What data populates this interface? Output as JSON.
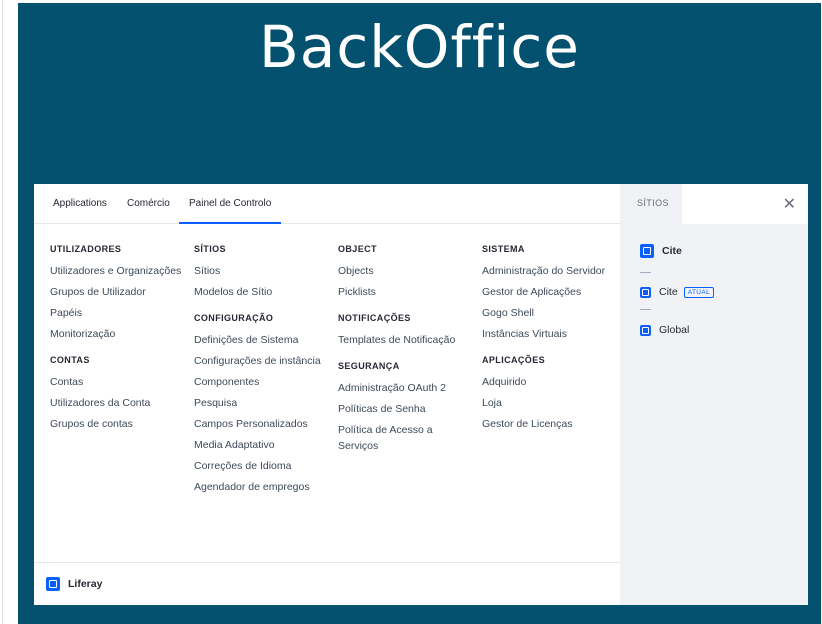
{
  "banner": {
    "title": "BackOffice"
  },
  "tabs": [
    {
      "label": "Applications"
    },
    {
      "label": "Comércio"
    },
    {
      "label": "Painel de Controlo"
    }
  ],
  "columns": [
    {
      "sections": [
        {
          "title": "UTILIZADORES",
          "items": [
            "Utilizadores e Organizações",
            "Grupos de Utilizador",
            "Papéis",
            "Monitorização"
          ]
        },
        {
          "title": "CONTAS",
          "items": [
            "Contas",
            "Utilizadores da Conta",
            "Grupos de contas"
          ]
        }
      ]
    },
    {
      "sections": [
        {
          "title": "SÍTIOS",
          "items": [
            "Sítios",
            "Modelos de Sítio"
          ]
        },
        {
          "title": "CONFIGURAÇÃO",
          "items": [
            "Definições de Sistema",
            "Configurações de instância",
            "Componentes",
            "Pesquisa",
            "Campos Personalizados",
            "Media Adaptativo",
            "Correções de Idioma",
            "Agendador de empregos"
          ]
        }
      ]
    },
    {
      "sections": [
        {
          "title": "OBJECT",
          "items": [
            "Objects",
            "Picklists"
          ]
        },
        {
          "title": "NOTIFICAÇÕES",
          "items": [
            "Templates de Notificação"
          ]
        },
        {
          "title": "SEGURANÇA",
          "items": [
            "Administração OAuth 2",
            "Políticas de Senha",
            "Política de Acesso a Serviços"
          ]
        }
      ]
    },
    {
      "sections": [
        {
          "title": "SISTEMA",
          "items": [
            "Administração do Servidor",
            "Gestor de Aplicações",
            "Gogo Shell",
            "Instâncias Virtuais"
          ]
        },
        {
          "title": "APLICAÇÕES",
          "items": [
            "Adquirido",
            "Loja",
            "Gestor de Licenças"
          ]
        }
      ]
    }
  ],
  "footer": {
    "brand": "Liferay",
    "icon": "liferay-logo-icon"
  },
  "sites_panel": {
    "tab_label": "SÍTIOS",
    "close_icon": "close-icon",
    "sites": [
      {
        "name": "Cite",
        "icon": "site-icon"
      },
      {
        "name": "Cite",
        "badge": "ATUAL",
        "icon": "site-icon"
      },
      {
        "name": "Global",
        "icon": "site-icon"
      }
    ]
  },
  "colors": {
    "banner": "#03506f",
    "accent": "#0b5fff",
    "sites_bg": "#f1f2f5"
  }
}
